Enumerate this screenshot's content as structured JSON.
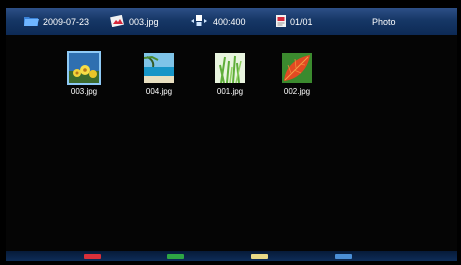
{
  "header": {
    "date": "2009-07-23",
    "file_name": "003.jpg",
    "resolution": "400:400",
    "page": "01/01",
    "mode": "Photo",
    "icons": [
      "folder-icon",
      "image-file-icon",
      "resolution-icon",
      "page-icon"
    ]
  },
  "thumbnails": [
    {
      "label": "003.jpg",
      "selected": true,
      "image": "flowers-icon"
    },
    {
      "label": "004.jpg",
      "selected": false,
      "image": "beach-icon"
    },
    {
      "label": "001.jpg",
      "selected": false,
      "image": "grass-icon"
    },
    {
      "label": "002.jpg",
      "selected": false,
      "image": "leaf-icon"
    }
  ],
  "color_keys": [
    {
      "name": "red",
      "color": "#d9303a"
    },
    {
      "name": "green",
      "color": "#2ea644"
    },
    {
      "name": "yellow",
      "color": "#e8d986"
    },
    {
      "name": "blue",
      "color": "#4b8fd6"
    }
  ]
}
